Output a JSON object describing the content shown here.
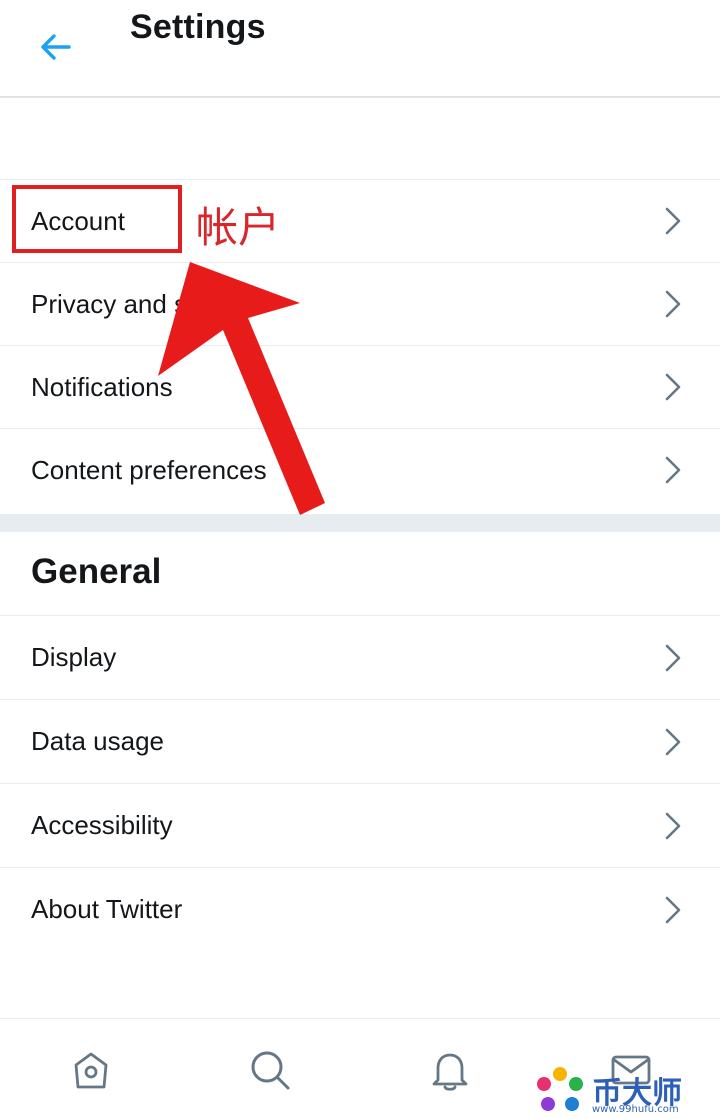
{
  "header": {
    "title": "Settings",
    "back_icon": "back-arrow-icon"
  },
  "account_section": {
    "items": [
      {
        "label": "Account"
      },
      {
        "label": "Privacy and safety"
      },
      {
        "label": "Notifications"
      },
      {
        "label": "Content preferences"
      }
    ]
  },
  "general_section": {
    "title": "General",
    "items": [
      {
        "label": "Display"
      },
      {
        "label": "Data usage"
      },
      {
        "label": "Accessibility"
      },
      {
        "label": "About Twitter"
      }
    ]
  },
  "annotation": {
    "text": "帐户",
    "color": "#e02020"
  },
  "bottom_nav": {
    "items": [
      "home-icon",
      "search-icon",
      "notifications-icon",
      "messages-icon"
    ]
  },
  "watermark": {
    "text": "币大师",
    "url": "www.99hufu.com"
  },
  "colors": {
    "accent": "#1da1f2",
    "icon": "#657786",
    "divider": "#e6ecf0"
  }
}
